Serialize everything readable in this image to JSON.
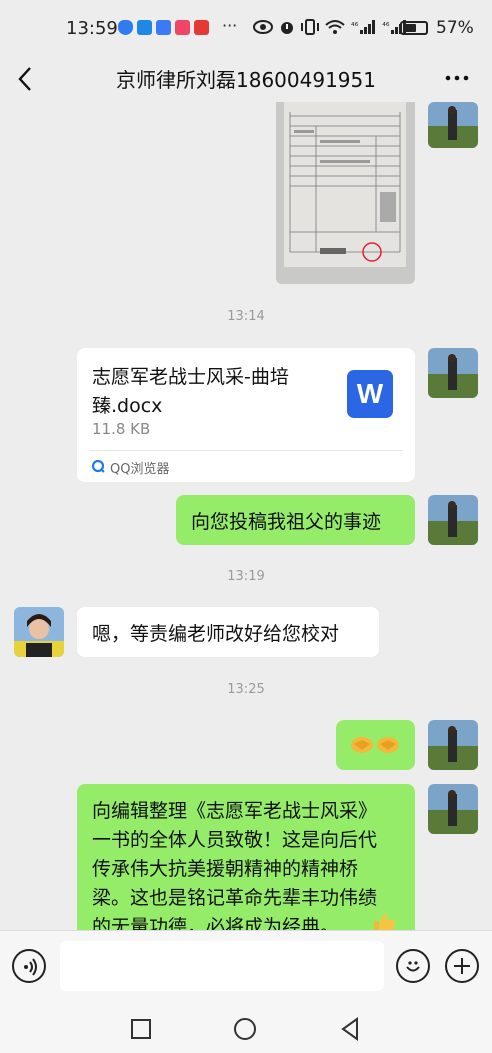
{
  "status": {
    "time": "13:59",
    "dots": "···",
    "signal1": "⁴⁶",
    "signal2": "⁴⁶",
    "battery": "57%"
  },
  "header": {
    "title": "京师律所刘磊18600491951"
  },
  "messages": {
    "ts1": "13:14",
    "file": {
      "name": "志愿军老战士风采-曲培臻.docx",
      "name_line1": "志愿军老战士风采-曲培",
      "name_line2": "臻.docx",
      "size": "11.8 KB",
      "source": "QQ浏览器",
      "badge": "W"
    },
    "msg_submit": "向您投稿我祖父的事迹",
    "ts2": "13:19",
    "reply": "嗯，等责编老师改好给您校对",
    "ts3": "13:25",
    "long_lines": [
      "向编辑整理《志愿军老战士风采》",
      "一书的全体人员致敬！这是向后代",
      "传承伟大抗美援朝精神的精神桥",
      "梁。这也是铭记革命先辈丰功伟绩",
      "的无量功德，必将成为经典。"
    ]
  },
  "colors": {
    "accent_green": "#95ec69",
    "word_blue": "#2b66e4"
  }
}
